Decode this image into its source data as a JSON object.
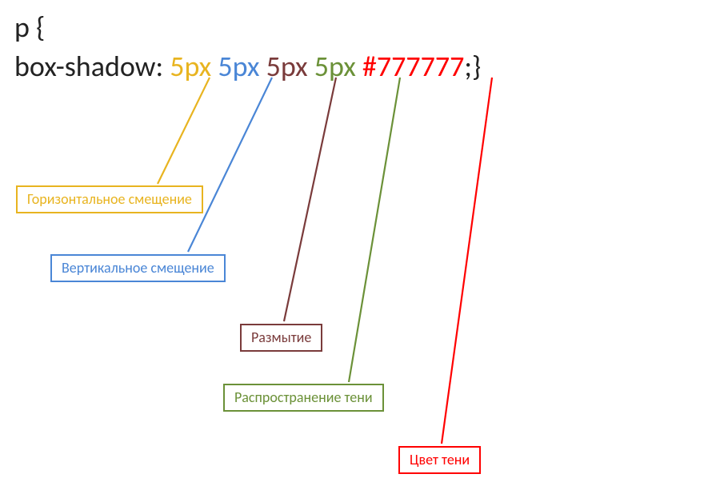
{
  "code": {
    "line1": "p {",
    "prop": "box-shadow: ",
    "v1": "5px",
    "v2": "5px",
    "v3": "5px",
    "v4": "5px",
    "v5": "#777777",
    "tail": ";}"
  },
  "labels": {
    "l1": "Горизонтальное смещение",
    "l2": "Вертикальное смещение",
    "l3": "Размытие",
    "l4": "Распространение тени",
    "l5": "Цвет тени"
  },
  "colors": {
    "c1": "#e8b420",
    "c2": "#4a86d6",
    "c3": "#7a3b3b",
    "c4": "#6b9138",
    "c5": "#ff0000",
    "text": "#222222"
  }
}
